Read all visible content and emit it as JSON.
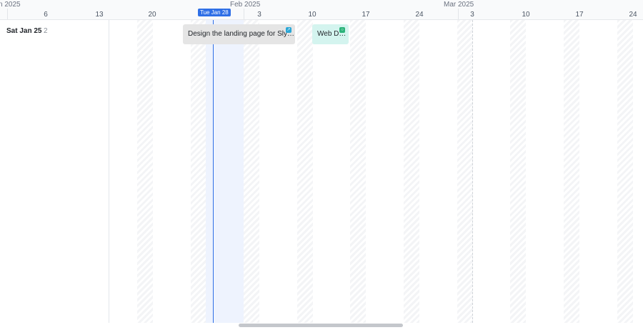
{
  "header": {
    "months": [
      "n 2025",
      "Feb 2025",
      "Mar 2025"
    ],
    "days": [
      "6",
      "13",
      "20",
      "3",
      "10",
      "17",
      "24",
      "3",
      "10",
      "17",
      "24"
    ],
    "today_label": "Tue Jan 28"
  },
  "group": {
    "label": "Sat Jan 25",
    "count": "2"
  },
  "tasks": [
    {
      "label": "Design the landing page for Sly…",
      "icon": "rocket-icon",
      "color": "#e5e5e5",
      "icon_color": "#2aa7d6"
    },
    {
      "label": "Web D…",
      "icon": "chat-icon",
      "color": "#d4f4ef",
      "icon_color": "#2cb37a"
    }
  ]
}
